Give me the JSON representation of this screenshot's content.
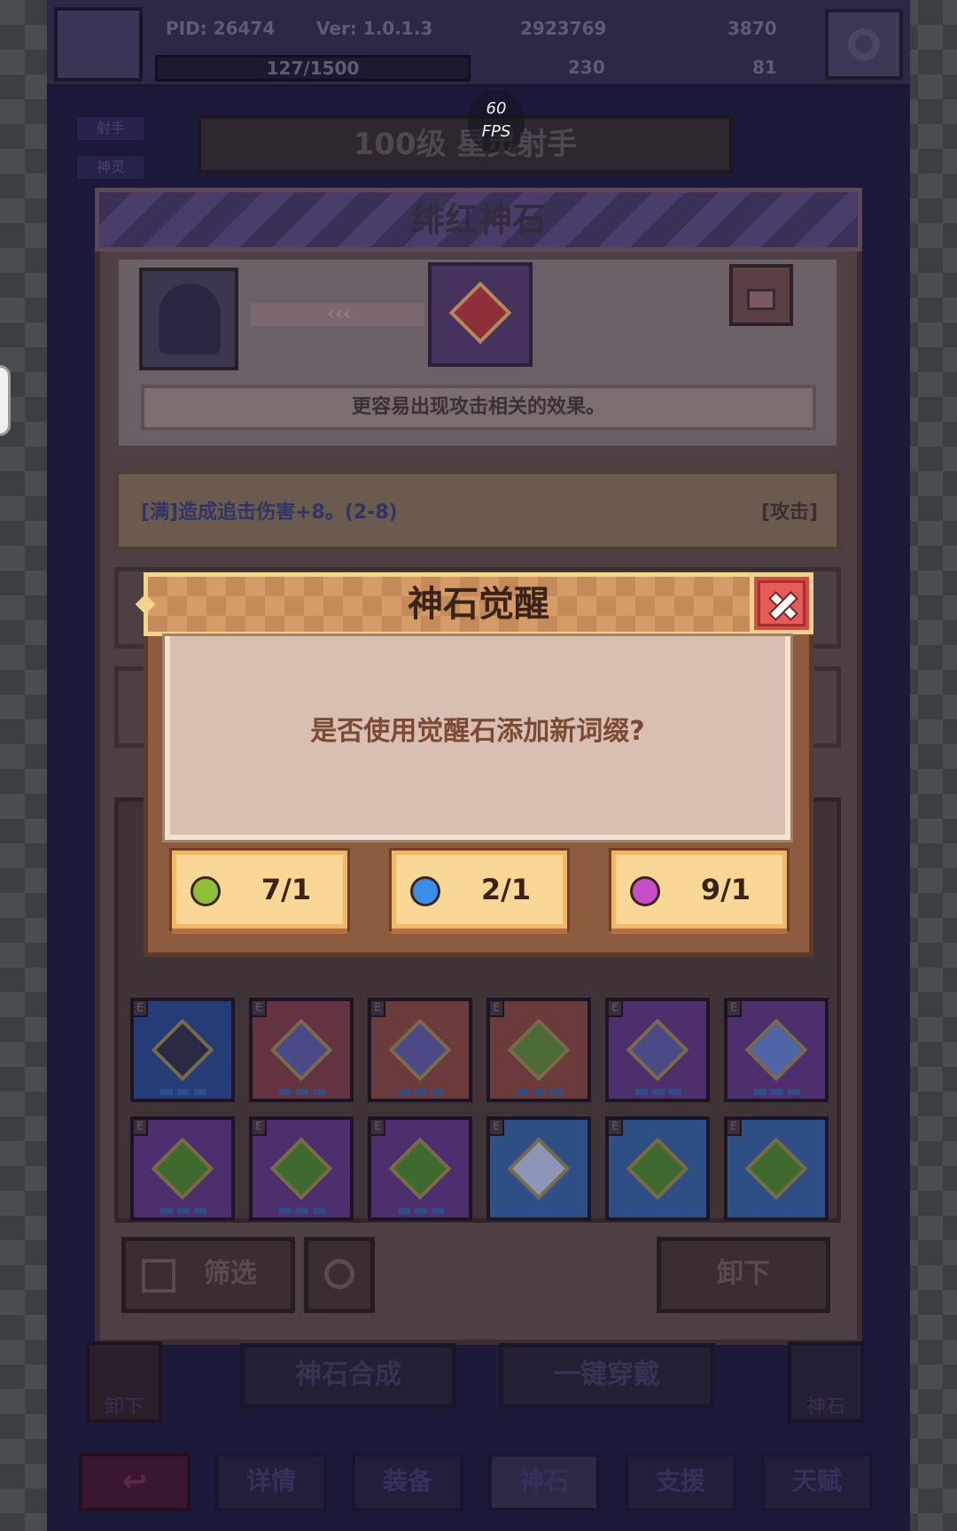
{
  "hud": {
    "pid": "PID: 26474",
    "version": "Ver: 1.0.1.3",
    "energy": "127/1500",
    "currency_a": "2923769",
    "currency_b": "3870",
    "currency_c": "230",
    "currency_d": "81"
  },
  "fps": {
    "value": "60",
    "label": "FPS"
  },
  "background": {
    "hero_title": "100级 星灵射手",
    "side_tags": [
      "射手",
      "神灵"
    ],
    "panel_title": "绯红神石",
    "description": "更容易出现攻击相关的效果。",
    "affix_text": "[满]造成追击伤害+8。(2-8)",
    "affix_tag": "[攻击]",
    "filter_label": "筛选",
    "unequip_label": "卸下",
    "compose_label": "神石合成",
    "equip_all_label": "一键穿戴",
    "left_corner_label": "卸下",
    "right_corner_label": "神石",
    "nav": [
      "详情",
      "装备",
      "神石",
      "支援",
      "天赋"
    ]
  },
  "modal": {
    "title": "神石觉醒",
    "question": "是否使用觉醒石添加新词缀?",
    "costs": [
      {
        "icon": "green-orb-icon",
        "color": "#8fbf3a",
        "value": "7/1"
      },
      {
        "icon": "blue-orb-icon",
        "color": "#3a8ee6",
        "value": "2/1"
      },
      {
        "icon": "purple-orb-icon",
        "color": "#c44fc9",
        "value": "9/1"
      }
    ]
  },
  "colors": {
    "modal_frame": "#8d5b3e",
    "modal_body": "#d9bfb1",
    "button_fill": "#f8d797",
    "close_red": "#d24b47"
  }
}
